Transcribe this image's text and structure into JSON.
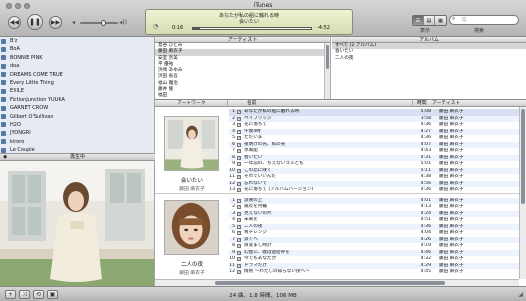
{
  "window": {
    "title": "iTunes"
  },
  "controls": {
    "prev": "◀◀",
    "play_pause": "❚❚",
    "next": "▶▶",
    "vol_low": "◂",
    "vol_high": "◂))",
    "volume_level": 0.62
  },
  "now_playing": {
    "song": "あなたが私の船に触れる時",
    "album": "会いたい",
    "elapsed": "0:16",
    "remaining": "-4:52",
    "progress": 0.06
  },
  "view": {
    "label": "表示",
    "icons": [
      "list-view",
      "album-view",
      "coverflow-view"
    ]
  },
  "search": {
    "label": "検索",
    "placeholder": "Q"
  },
  "sources": [
    "B'z",
    "BoA",
    "BONNIE PINK",
    "doa",
    "DREAMS COME TRUE",
    "Every Little Thing",
    "EXILE",
    "FictionJunction YUUKA",
    "GARNET CROW",
    "Gilbert O'Sullivan",
    "H2O",
    "JYONGRI",
    "kiroro",
    "Le Couple",
    "melody."
  ],
  "artwork_pane": {
    "label": "再生中"
  },
  "browser": {
    "artist_header": "アーティスト",
    "album_header": "アルバム",
    "artists": [
      "島谷 ひとみ",
      "藤田 麻衣子",
      "安室 奈美",
      "平 優祐",
      "浜崎 あゆみ",
      "浜田 省吾",
      "福山 雅治",
      "藤井 隆",
      "福田",
      "平井 堅"
    ],
    "albums": [
      "すべて (2 アルバム)",
      "会いたい",
      "二人の夜"
    ]
  },
  "list": {
    "headers": {
      "artwork": "アートワーク",
      "name": "名前",
      "time": "時間",
      "artist": "アーティスト"
    },
    "albums": [
      {
        "title": "会いたい",
        "artist": "藤田 麻衣子"
      },
      {
        "title": "二人の夜",
        "artist": "藤田 麻衣子"
      }
    ],
    "tracks": [
      {
        "num": "1",
        "name": "あなたが私の船に触れる時",
        "time": "5:08",
        "artist": "藤田 麻衣子"
      },
      {
        "num": "2",
        "name": "ペイブリッジ",
        "time": "3:58",
        "artist": "藤田 麻衣子"
      },
      {
        "num": "3",
        "name": "花に落ちて",
        "time": "4:36",
        "artist": "藤田 麻衣子"
      },
      {
        "num": "4",
        "name": "午後4時",
        "time": "4:27",
        "artist": "藤田 麻衣子"
      },
      {
        "num": "5",
        "name": "ただいま",
        "time": "4:36",
        "artist": "藤田 麻衣子"
      },
      {
        "num": "6",
        "name": "夜明けの光、私の光",
        "time": "4:07",
        "artist": "藤田 麻衣子"
      },
      {
        "num": "7",
        "name": "水風船",
        "time": "4:43",
        "artist": "藤田 麻衣子"
      },
      {
        "num": "8",
        "name": "会いたい",
        "time": "4:31",
        "artist": "藤田 麻衣子"
      },
      {
        "num": "9",
        "name": "一年前の、ちえないゴミとも",
        "time": "5:01",
        "artist": "藤田 麻衣子"
      },
      {
        "num": "10",
        "name": "この恋に咲く",
        "time": "5:11",
        "artist": "藤田 麻衣子"
      },
      {
        "num": "11",
        "name": "それでいいんだ",
        "time": "4:38",
        "artist": "藤田 麻衣子"
      },
      {
        "num": "12",
        "name": "忘れないで",
        "time": "4:56",
        "artist": "藤田 麻衣子"
      },
      {
        "num": "13",
        "name": "花に落ちて (アルバムバージョン)",
        "time": "4:36",
        "artist": "藤田 麻衣子"
      },
      {
        "num": "1",
        "name": "涙咲の上",
        "time": "4:01",
        "artist": "藤田 麻衣子"
      },
      {
        "num": "2",
        "name": "陽炎を月輪",
        "time": "4:13",
        "artist": "藤田 麻衣子"
      },
      {
        "num": "3",
        "name": "見えないの片",
        "time": "4:24",
        "artist": "藤田 麻衣子"
      },
      {
        "num": "4",
        "name": "未来を",
        "time": "4:51",
        "artist": "藤田 麻衣子"
      },
      {
        "num": "5",
        "name": "二人の夜",
        "time": "4:36",
        "artist": "藤田 麻衣子"
      },
      {
        "num": "6",
        "name": "青チレンジ",
        "time": "4:04",
        "artist": "藤田 麻衣子"
      },
      {
        "num": "7",
        "name": "涙くへ",
        "time": "4:26",
        "artist": "藤田 麻衣子"
      },
      {
        "num": "8",
        "name": "目覚まし時計",
        "time": "4:19",
        "artist": "藤田 麻衣子"
      },
      {
        "num": "9",
        "name": "幻歴に、嘘は過密弁を",
        "time": "4:46",
        "artist": "藤田 麻衣子"
      },
      {
        "num": "10",
        "name": "今でもあなたが",
        "time": "4:32",
        "artist": "藤田 麻衣子"
      },
      {
        "num": "11",
        "name": "ドラマだけ",
        "time": "4:29",
        "artist": "藤田 麻衣子"
      },
      {
        "num": "12",
        "name": "情熱 ～わたしの知らない街へ～",
        "time": "4:45",
        "artist": "藤田 麻衣子"
      }
    ]
  },
  "status": {
    "text": "24 曲、1.8 時間、106 MB"
  },
  "bottom_buttons": [
    "+",
    "⤨",
    "⟲",
    "▣"
  ],
  "colors": {
    "lcd": "#e6ebc6",
    "source_bg": "#e6ebf2",
    "row_alt": "#edf3fe",
    "selection": "#c5cfdc"
  }
}
